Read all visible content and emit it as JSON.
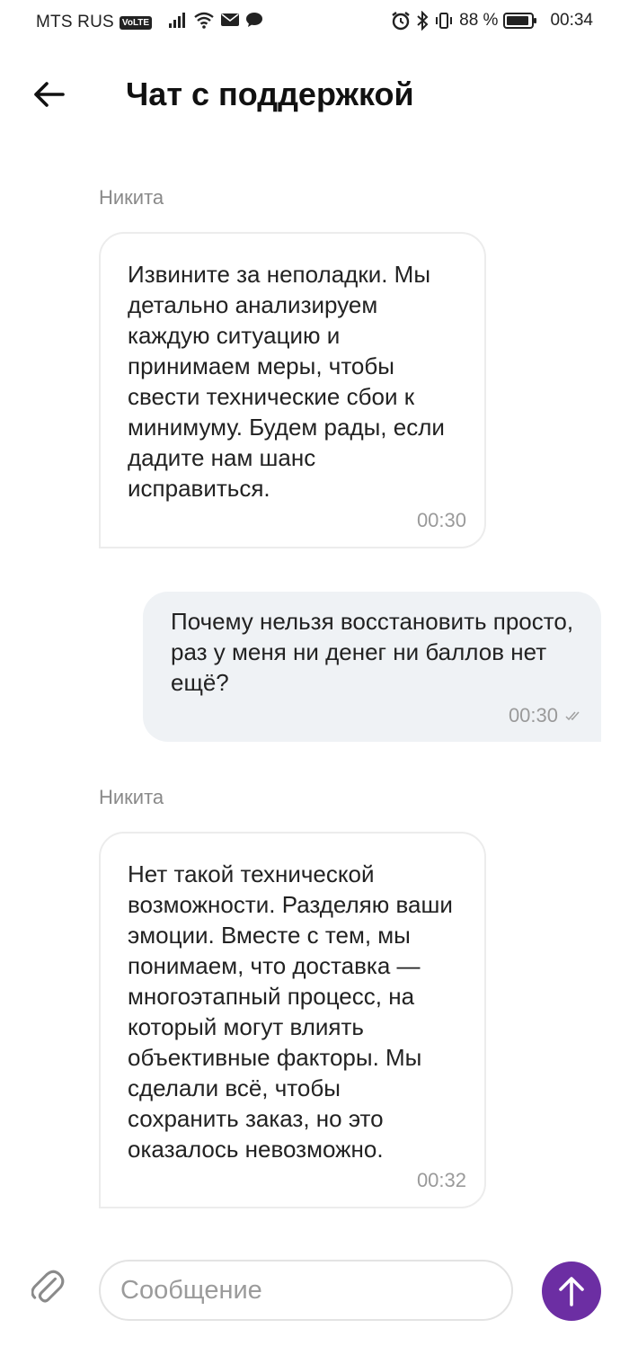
{
  "status_bar": {
    "carrier": "MTS RUS",
    "volte": "VoLTE",
    "battery": "88 %",
    "time": "00:34"
  },
  "header": {
    "title": "Чат с поддержкой"
  },
  "messages": [
    {
      "sender": "Никита",
      "text": "Извините за неполадки. Мы детально анализируем каждую ситуацию и принимаем меры, чтобы свести технические сбои к минимуму. Будем рады, если дадите нам шанс исправиться.",
      "time": "00:30"
    },
    {
      "text": "Почему нельзя восстановить просто, раз у меня ни денег ни баллов нет ещё?",
      "time": "00:30"
    },
    {
      "sender": "Никита",
      "text": "Нет такой технической возможности. Разделяю ваши эмоции. Вместе с тем, мы понимаем, что доставка — многоэтапный процесс, на который могут влиять объективные факторы. Мы сделали всё, чтобы сохранить заказ, но это оказалось невозможно.",
      "time": "00:32"
    }
  ],
  "composer": {
    "placeholder": "Сообщение"
  },
  "colors": {
    "accent": "#6c2ea3",
    "outgoing_bubble": "#eff2f5",
    "incoming_border": "#ececec",
    "meta_text": "#9a9a9a"
  }
}
